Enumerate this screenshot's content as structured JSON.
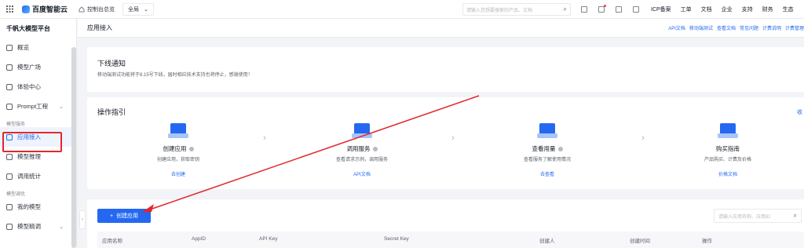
{
  "topbar": {
    "brand": "百度智能云",
    "console": "控制台总览",
    "region": "全局",
    "search_placeholder": "请输入您想要搜索的产品、文档",
    "links": [
      "ICP备案",
      "工单",
      "文档",
      "企业",
      "支持",
      "财务",
      "生态"
    ]
  },
  "sidebar": {
    "title": "千帆大模型平台",
    "items_top": [
      "概览",
      "模型广场",
      "体验中心",
      "Prompt工程"
    ],
    "group_service": "模型服务",
    "items_service": [
      "应用接入",
      "模型推理",
      "调用统计"
    ],
    "group_tune": "模型调优",
    "items_tune": [
      "我的模型",
      "模型精调"
    ]
  },
  "subhead": {
    "title": "应用接入",
    "doc_links": [
      "API文档",
      "移动端测试",
      "查看文档",
      "常见问题",
      "计费说明",
      "计费管理"
    ]
  },
  "notice": {
    "title": "下线通知",
    "text": "移动端测试功能将于8.15号下线，届时相应技术支持也将停止，感谢使用！"
  },
  "guide": {
    "title": "操作指引",
    "more": "收",
    "steps": [
      {
        "title": "创建应用",
        "desc": "创建应用，获取密钥",
        "link": "去创建"
      },
      {
        "title": "调用服务",
        "desc": "查看请求示例，调用服务",
        "link": "API文档"
      },
      {
        "title": "查看用量",
        "desc": "查看服务了解使用情况",
        "link": "去查看"
      },
      {
        "title": "购买指南",
        "desc": "产品购买、计费及价格",
        "link": "价格文档"
      }
    ]
  },
  "apps": {
    "create_button": "创建应用",
    "search_placeholder": "请输入应用名称、应用ID",
    "columns": [
      "应用名称",
      "AppID",
      "API Key",
      "Secret Key",
      "创建人",
      "创建时间",
      "操作"
    ]
  },
  "colors": {
    "accent": "#2468f2",
    "annotation": "#e3262b"
  }
}
